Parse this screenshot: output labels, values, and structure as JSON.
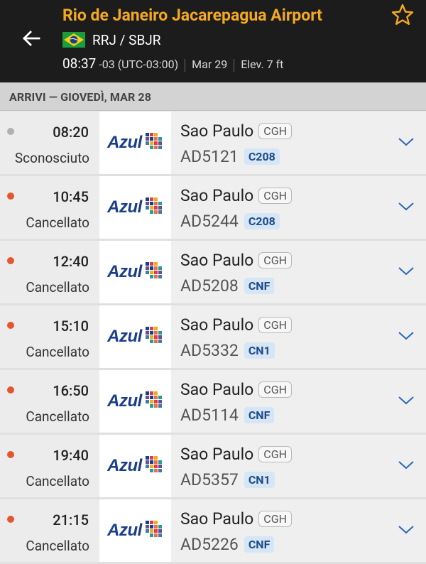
{
  "header": {
    "airport_name": "Rio de Janeiro Jacarepagua Airport",
    "codes": "RRJ / SBJR",
    "local_time": "08:37",
    "timezone": "-03 (UTC-03:00)",
    "date": "Mar 29",
    "elevation": "Elev. 7 ft",
    "accent_color": "#f4a91f"
  },
  "section_title": "ARRIVI — GIOVEDÌ, MAR 28",
  "flights": [
    {
      "time": "08:20",
      "status": "Sconosciuto",
      "status_color": "#b0b0b0",
      "airline": "Azul",
      "city": "Sao Paulo",
      "iata": "CGH",
      "flight": "AD5121",
      "aircraft": "C208"
    },
    {
      "time": "10:45",
      "status": "Cancellato",
      "status_color": "#e4572e",
      "airline": "Azul",
      "city": "Sao Paulo",
      "iata": "CGH",
      "flight": "AD5244",
      "aircraft": "C208"
    },
    {
      "time": "12:40",
      "status": "Cancellato",
      "status_color": "#e4572e",
      "airline": "Azul",
      "city": "Sao Paulo",
      "iata": "CGH",
      "flight": "AD5208",
      "aircraft": "CNF"
    },
    {
      "time": "15:10",
      "status": "Cancellato",
      "status_color": "#e4572e",
      "airline": "Azul",
      "city": "Sao Paulo",
      "iata": "CGH",
      "flight": "AD5332",
      "aircraft": "CN1"
    },
    {
      "time": "16:50",
      "status": "Cancellato",
      "status_color": "#e4572e",
      "airline": "Azul",
      "city": "Sao Paulo",
      "iata": "CGH",
      "flight": "AD5114",
      "aircraft": "CNF"
    },
    {
      "time": "19:40",
      "status": "Cancellato",
      "status_color": "#e4572e",
      "airline": "Azul",
      "city": "Sao Paulo",
      "iata": "CGH",
      "flight": "AD5357",
      "aircraft": "CN1"
    },
    {
      "time": "21:15",
      "status": "Cancellato",
      "status_color": "#e4572e",
      "airline": "Azul",
      "city": "Sao Paulo",
      "iata": "CGH",
      "flight": "AD5226",
      "aircraft": "CNF"
    }
  ]
}
